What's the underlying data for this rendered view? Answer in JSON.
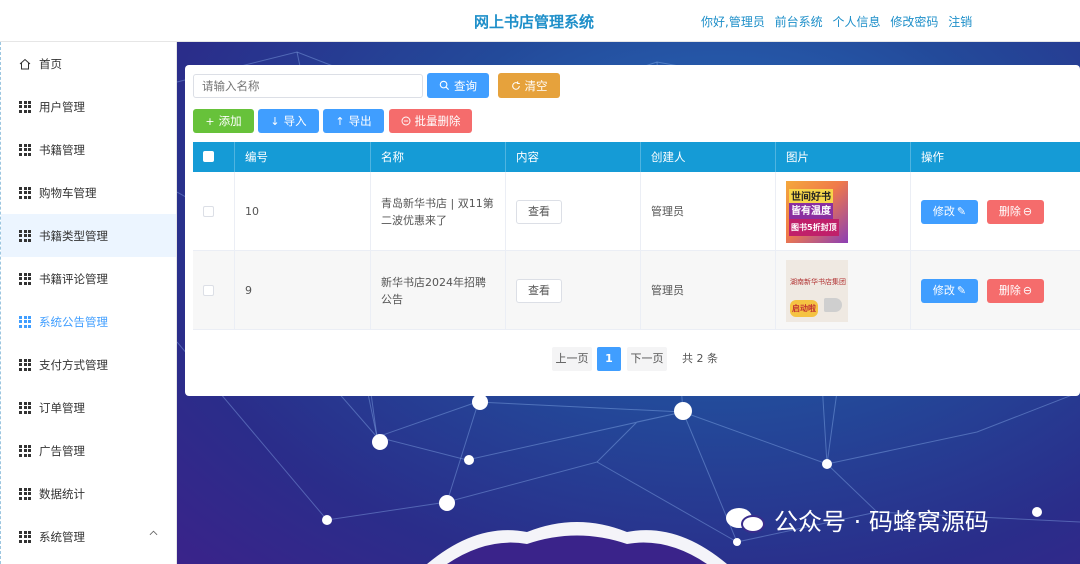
{
  "header": {
    "title": "网上书店管理系统",
    "nav": [
      "你好,管理员",
      "前台系统",
      "个人信息",
      "修改密码",
      "注销"
    ]
  },
  "sidebar": {
    "items": [
      {
        "label": "首页",
        "icon": "home-icon"
      },
      {
        "label": "用户管理",
        "icon": "grid-icon"
      },
      {
        "label": "书籍管理",
        "icon": "grid-icon"
      },
      {
        "label": "购物车管理",
        "icon": "grid-icon"
      },
      {
        "label": "书籍类型管理",
        "icon": "grid-icon"
      },
      {
        "label": "书籍评论管理",
        "icon": "grid-icon"
      },
      {
        "label": "系统公告管理",
        "icon": "grid-icon",
        "active": true
      },
      {
        "label": "支付方式管理",
        "icon": "grid-icon"
      },
      {
        "label": "订单管理",
        "icon": "grid-icon"
      },
      {
        "label": "广告管理",
        "icon": "grid-icon"
      },
      {
        "label": "数据统计",
        "icon": "grid-icon"
      },
      {
        "label": "系统管理",
        "icon": "grid-icon",
        "chevron": "chevron-up-icon"
      }
    ]
  },
  "search": {
    "placeholder": "请输入名称",
    "query_label": "查询",
    "clear_label": "清空"
  },
  "toolbar": {
    "add_label": "添加",
    "import_label": "导入",
    "export_label": "导出",
    "batch_delete_label": "批量删除"
  },
  "table": {
    "columns": [
      "编号",
      "名称",
      "内容",
      "创建人",
      "图片",
      "操作"
    ],
    "rows": [
      {
        "id": "10",
        "name": "青岛新华书店 | 双11第二波优惠来了",
        "content_btn": "查看",
        "creator": "管理员",
        "edit": "修改",
        "delete": "删除",
        "image_text": [
          "世间好书",
          "皆有温度",
          "图书5折封顶"
        ]
      },
      {
        "id": "9",
        "name": "新华书店2024年招聘公告",
        "content_btn": "查看",
        "creator": "管理员",
        "edit": "修改",
        "delete": "删除",
        "image_text": [
          "湖南新华书店集团",
          "启动啦"
        ]
      }
    ]
  },
  "pagination": {
    "prev": "上一页",
    "current": "1",
    "next": "下一页",
    "total": "共 2 条"
  },
  "watermark": "公众号 · 码蜂窝源码",
  "colors": {
    "header_title": "#1e8fc9",
    "table_header": "#159bd6",
    "primary": "#409eff",
    "warning": "#e6a23c",
    "success": "#67c23a",
    "danger": "#f56c6c"
  }
}
